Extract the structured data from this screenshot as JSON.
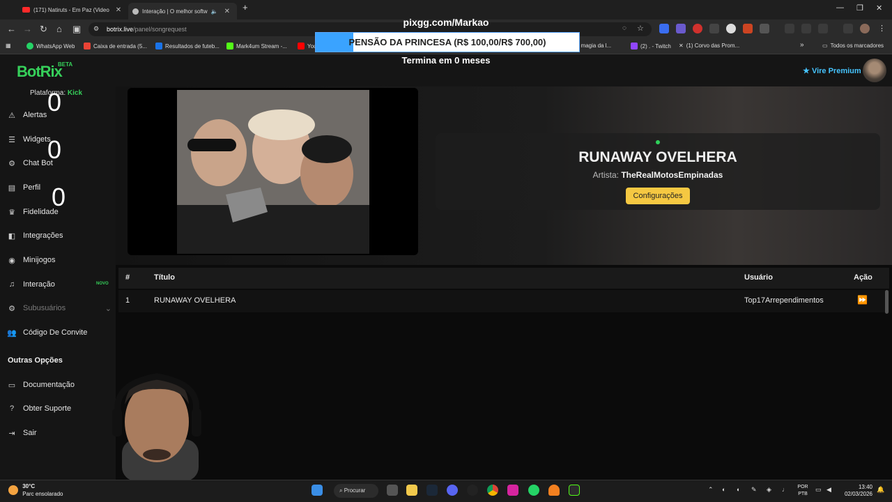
{
  "browser": {
    "tabs": [
      {
        "title": "(171) Natiruts - Em Paz (Video",
        "active": false
      },
      {
        "title": "Interação | O melhor softw",
        "active": true
      }
    ],
    "new_tab": "+",
    "url_domain": "botrix.live",
    "url_path": "/panel/songrequest",
    "bookmarks": [
      "WhatsApp Web",
      "Caixa de entrada (5...",
      "Resultados de futeb...",
      "Mark4um Stream -...",
      "You",
      "u: A magia da l...",
      "(2) . - Twitch",
      "(1) Corvo das Prom..."
    ],
    "bookmarks_overflow": "»",
    "all_bookmarks": "Todos os marcadores"
  },
  "overlay": {
    "pix": "pixgg.com/Markao",
    "goal_text": "PENSÃO DA PRINCESA (R$ 100,00/R$ 700,00)",
    "goal_progress": 0.1429,
    "ends": "Termina em 0 meses"
  },
  "app": {
    "logo": "BotRix",
    "beta": "BETA",
    "premium": "Vire Premium",
    "platform_label": "Plataforma:",
    "platform_value": "Kick",
    "zeros": [
      "0",
      "0",
      "0"
    ],
    "sidebar": [
      {
        "label": "Alertas",
        "icon": "alert-icon"
      },
      {
        "label": "Widgets",
        "icon": "widgets-icon"
      },
      {
        "label": "Chat Bot",
        "icon": "bot-icon"
      },
      {
        "label": "Perfil",
        "icon": "profile-icon"
      },
      {
        "label": "Fidelidade",
        "icon": "trophy-icon"
      },
      {
        "label": "Integrações",
        "icon": "integrations-icon"
      },
      {
        "label": "Minijogos",
        "icon": "gamepad-icon"
      },
      {
        "label": "Interação",
        "icon": "music-icon"
      },
      {
        "label": "Subusuários",
        "icon": "subusers-icon"
      },
      {
        "label": "Código De Convite",
        "icon": "invite-icon"
      }
    ],
    "new_badge": "NOVO",
    "other_options": "Outras Opções",
    "other_items": [
      {
        "label": "Documentação",
        "icon": "docs-icon"
      },
      {
        "label": "Obter Suporte",
        "icon": "help-icon"
      },
      {
        "label": "Sair",
        "icon": "logout-icon"
      }
    ]
  },
  "now_playing": {
    "title": "RUNAWAY OVELHERA",
    "artist_label": "Artista:",
    "artist": "TheRealMotosEmpinadas",
    "settings_button": "Configurações"
  },
  "queue": {
    "headers": {
      "num": "#",
      "title": "Título",
      "user": "Usuário",
      "action": "Ação"
    },
    "rows": [
      {
        "num": "1",
        "title": "RUNAWAY OVELHERA",
        "user": "Top17Arrependimentos"
      }
    ]
  },
  "taskbar": {
    "temp": "30°C",
    "weather": "Parc ensolarado",
    "search": "Procurar",
    "lang1": "POR",
    "lang2": "PTB",
    "time": "13:40",
    "date": "02/03/2026"
  }
}
